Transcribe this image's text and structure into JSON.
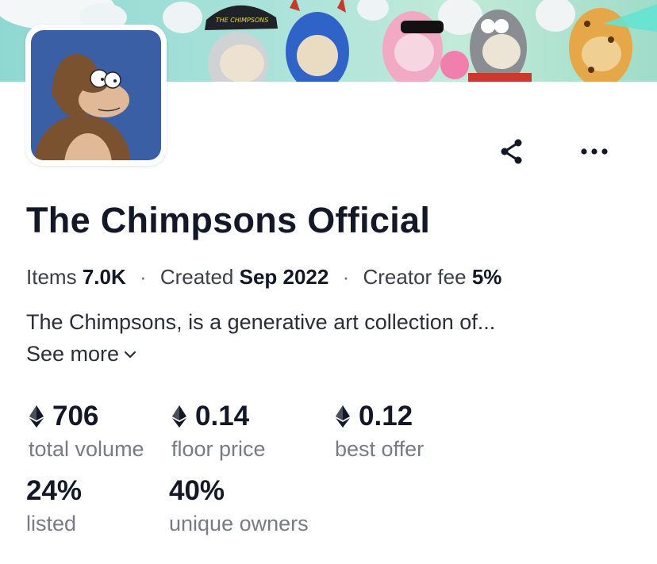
{
  "collection": {
    "name": "The Chimpsons Official",
    "meta": {
      "items_label": "Items",
      "items_value": "7.0K",
      "created_label": "Created",
      "created_value": "Sep 2022",
      "fee_label": "Creator fee",
      "fee_value": "5%",
      "separator": "·"
    },
    "description": "The Chimpsons, is a generative art collection of...",
    "see_more_label": "See more",
    "banner_hat_text": "THE CHIMPSONS"
  },
  "stats": [
    {
      "value": "706",
      "label": "total volume",
      "currency": "eth"
    },
    {
      "value": "0.14",
      "label": "floor price",
      "currency": "eth"
    },
    {
      "value": "0.12",
      "label": "best offer",
      "currency": "eth"
    },
    {
      "value": "24%",
      "label": "listed"
    },
    {
      "value": "40%",
      "label": "unique owners"
    }
  ],
  "icons": {
    "share": "share-icon",
    "more": "more-horizontal-icon",
    "chevron": "chevron-down-icon",
    "currency": "ethereum-icon"
  },
  "colors": {
    "banner_bg": "#a9e2da",
    "avatar_bg": "#3b5fa4",
    "text_primary": "#121826",
    "text_muted": "#767b85"
  }
}
